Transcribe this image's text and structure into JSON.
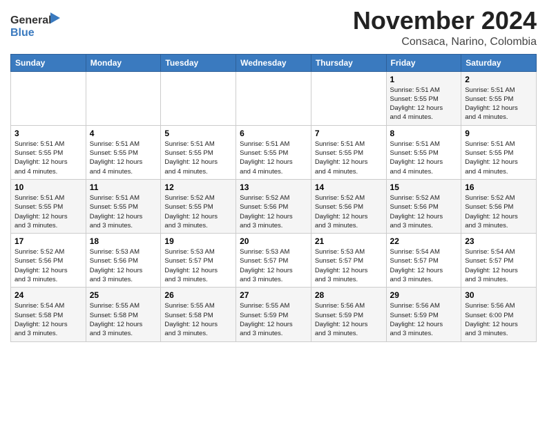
{
  "logo": {
    "text1": "General",
    "text2": "Blue"
  },
  "title": "November 2024",
  "location": "Consaca, Narino, Colombia",
  "weekdays": [
    "Sunday",
    "Monday",
    "Tuesday",
    "Wednesday",
    "Thursday",
    "Friday",
    "Saturday"
  ],
  "weeks": [
    [
      {
        "day": "",
        "info": ""
      },
      {
        "day": "",
        "info": ""
      },
      {
        "day": "",
        "info": ""
      },
      {
        "day": "",
        "info": ""
      },
      {
        "day": "",
        "info": ""
      },
      {
        "day": "1",
        "info": "Sunrise: 5:51 AM\nSunset: 5:55 PM\nDaylight: 12 hours\nand 4 minutes."
      },
      {
        "day": "2",
        "info": "Sunrise: 5:51 AM\nSunset: 5:55 PM\nDaylight: 12 hours\nand 4 minutes."
      }
    ],
    [
      {
        "day": "3",
        "info": "Sunrise: 5:51 AM\nSunset: 5:55 PM\nDaylight: 12 hours\nand 4 minutes."
      },
      {
        "day": "4",
        "info": "Sunrise: 5:51 AM\nSunset: 5:55 PM\nDaylight: 12 hours\nand 4 minutes."
      },
      {
        "day": "5",
        "info": "Sunrise: 5:51 AM\nSunset: 5:55 PM\nDaylight: 12 hours\nand 4 minutes."
      },
      {
        "day": "6",
        "info": "Sunrise: 5:51 AM\nSunset: 5:55 PM\nDaylight: 12 hours\nand 4 minutes."
      },
      {
        "day": "7",
        "info": "Sunrise: 5:51 AM\nSunset: 5:55 PM\nDaylight: 12 hours\nand 4 minutes."
      },
      {
        "day": "8",
        "info": "Sunrise: 5:51 AM\nSunset: 5:55 PM\nDaylight: 12 hours\nand 4 minutes."
      },
      {
        "day": "9",
        "info": "Sunrise: 5:51 AM\nSunset: 5:55 PM\nDaylight: 12 hours\nand 4 minutes."
      }
    ],
    [
      {
        "day": "10",
        "info": "Sunrise: 5:51 AM\nSunset: 5:55 PM\nDaylight: 12 hours\nand 3 minutes."
      },
      {
        "day": "11",
        "info": "Sunrise: 5:51 AM\nSunset: 5:55 PM\nDaylight: 12 hours\nand 3 minutes."
      },
      {
        "day": "12",
        "info": "Sunrise: 5:52 AM\nSunset: 5:55 PM\nDaylight: 12 hours\nand 3 minutes."
      },
      {
        "day": "13",
        "info": "Sunrise: 5:52 AM\nSunset: 5:56 PM\nDaylight: 12 hours\nand 3 minutes."
      },
      {
        "day": "14",
        "info": "Sunrise: 5:52 AM\nSunset: 5:56 PM\nDaylight: 12 hours\nand 3 minutes."
      },
      {
        "day": "15",
        "info": "Sunrise: 5:52 AM\nSunset: 5:56 PM\nDaylight: 12 hours\nand 3 minutes."
      },
      {
        "day": "16",
        "info": "Sunrise: 5:52 AM\nSunset: 5:56 PM\nDaylight: 12 hours\nand 3 minutes."
      }
    ],
    [
      {
        "day": "17",
        "info": "Sunrise: 5:52 AM\nSunset: 5:56 PM\nDaylight: 12 hours\nand 3 minutes."
      },
      {
        "day": "18",
        "info": "Sunrise: 5:53 AM\nSunset: 5:56 PM\nDaylight: 12 hours\nand 3 minutes."
      },
      {
        "day": "19",
        "info": "Sunrise: 5:53 AM\nSunset: 5:57 PM\nDaylight: 12 hours\nand 3 minutes."
      },
      {
        "day": "20",
        "info": "Sunrise: 5:53 AM\nSunset: 5:57 PM\nDaylight: 12 hours\nand 3 minutes."
      },
      {
        "day": "21",
        "info": "Sunrise: 5:53 AM\nSunset: 5:57 PM\nDaylight: 12 hours\nand 3 minutes."
      },
      {
        "day": "22",
        "info": "Sunrise: 5:54 AM\nSunset: 5:57 PM\nDaylight: 12 hours\nand 3 minutes."
      },
      {
        "day": "23",
        "info": "Sunrise: 5:54 AM\nSunset: 5:57 PM\nDaylight: 12 hours\nand 3 minutes."
      }
    ],
    [
      {
        "day": "24",
        "info": "Sunrise: 5:54 AM\nSunset: 5:58 PM\nDaylight: 12 hours\nand 3 minutes."
      },
      {
        "day": "25",
        "info": "Sunrise: 5:55 AM\nSunset: 5:58 PM\nDaylight: 12 hours\nand 3 minutes."
      },
      {
        "day": "26",
        "info": "Sunrise: 5:55 AM\nSunset: 5:58 PM\nDaylight: 12 hours\nand 3 minutes."
      },
      {
        "day": "27",
        "info": "Sunrise: 5:55 AM\nSunset: 5:59 PM\nDaylight: 12 hours\nand 3 minutes."
      },
      {
        "day": "28",
        "info": "Sunrise: 5:56 AM\nSunset: 5:59 PM\nDaylight: 12 hours\nand 3 minutes."
      },
      {
        "day": "29",
        "info": "Sunrise: 5:56 AM\nSunset: 5:59 PM\nDaylight: 12 hours\nand 3 minutes."
      },
      {
        "day": "30",
        "info": "Sunrise: 5:56 AM\nSunset: 6:00 PM\nDaylight: 12 hours\nand 3 minutes."
      }
    ]
  ]
}
